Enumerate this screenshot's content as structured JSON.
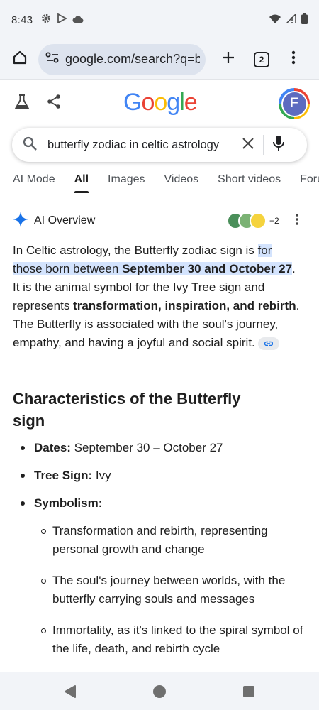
{
  "status_bar": {
    "time": "8:43"
  },
  "browser": {
    "url": "google.com/search?q=b",
    "tab_count": "2"
  },
  "google": {
    "logo_letters": [
      "G",
      "o",
      "o",
      "g",
      "l",
      "e"
    ],
    "avatar_letter": "F",
    "query": "butterfly zodiac in celtic astrology"
  },
  "tabs": [
    "AI Mode",
    "All",
    "Images",
    "Videos",
    "Short videos",
    "Forums"
  ],
  "active_tab": "All",
  "ai_overview": {
    "label": "AI Overview",
    "sources_more": "+2",
    "p_intro": "In Celtic astrology, the Butterfly zodiac sign is ",
    "p_hl1": "for those born between ",
    "p_hl2": "September 30 and October 27",
    "p_mid": ". It is the animal symbol for the Ivy Tree sign and represents ",
    "p_bold1": "transformation, inspiration, and rebirth",
    "p_end": ". The Butterfly is associated with the soul's journey, empathy, and having a joyful and social spirit."
  },
  "characteristics": {
    "title": "Characteristics of the Butterfly sign",
    "dates_label": "Dates:",
    "dates_value": " September 30 – October 27",
    "tree_label": "Tree Sign:",
    "tree_value": " Ivy",
    "symbolism_label": "Symbolism:",
    "symbolism_items": [
      "Transformation and rebirth, representing personal growth and change",
      "The soul's journey between worlds, with the butterfly carrying souls and messages",
      "Immortality, as it's linked to the spiral symbol of the life, death, and rebirth cycle"
    ]
  },
  "colors": {
    "highlight": "#d3e3fd",
    "chrome": "#f2f4f8",
    "url_pill": "#dde3ee",
    "avatar": "#5c6bc0"
  },
  "icons": [
    "settings-icon",
    "play-store-icon",
    "cloud-icon",
    "wifi-icon",
    "signal-icon",
    "battery-icon",
    "home-icon",
    "site-info-icon",
    "plus-icon",
    "tab-switcher-icon",
    "more-vert-icon",
    "flask-icon",
    "share-icon",
    "search-icon",
    "clear-icon",
    "mic-icon",
    "sparkle-icon",
    "link-icon",
    "nav-back-icon",
    "nav-home-icon",
    "nav-recents-icon"
  ]
}
